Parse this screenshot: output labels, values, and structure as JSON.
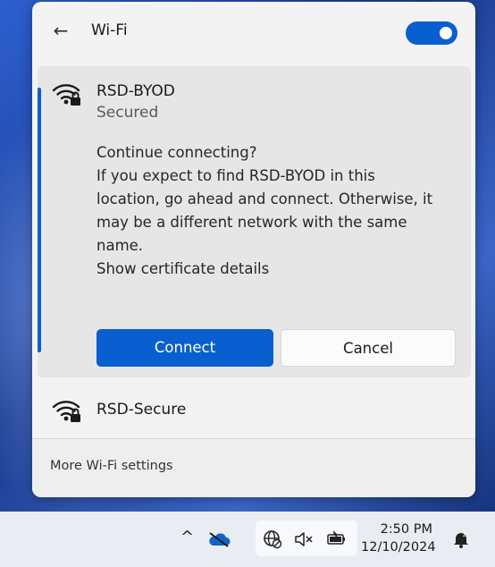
{
  "flyout": {
    "header": {
      "back_icon": "back-arrow-icon",
      "title": "Wi-Fi",
      "wifi_enabled": true
    },
    "selected_network": {
      "name": "RSD-BYOD",
      "status": "Secured",
      "icon": "wifi-secured-icon",
      "prompt_lines": [
        "Continue connecting?",
        "If you expect to find RSD-BYOD in this",
        "location, go ahead and connect. Otherwise, it",
        "may be a different network with the same",
        "name.",
        "Show certificate details"
      ],
      "connect_label": "Connect",
      "cancel_label": "Cancel"
    },
    "networks": [
      {
        "name": "RSD-Secure",
        "icon": "wifi-secured-icon"
      }
    ],
    "footer_link": "More Wi-Fi settings"
  },
  "taskbar": {
    "overflow_icon": "chevron-up-icon",
    "tray_icons": [
      "onedrive-icon",
      "network-globe-icon",
      "speaker-muted-icon",
      "battery-icon"
    ],
    "time": "2:50 PM",
    "date": "12/10/2024",
    "notification_icon": "notification-bell-icon"
  },
  "colors": {
    "accent": "#0a5fd0",
    "panel_bg": "#f3f3f3",
    "selected_bg": "#e6e6e6"
  }
}
